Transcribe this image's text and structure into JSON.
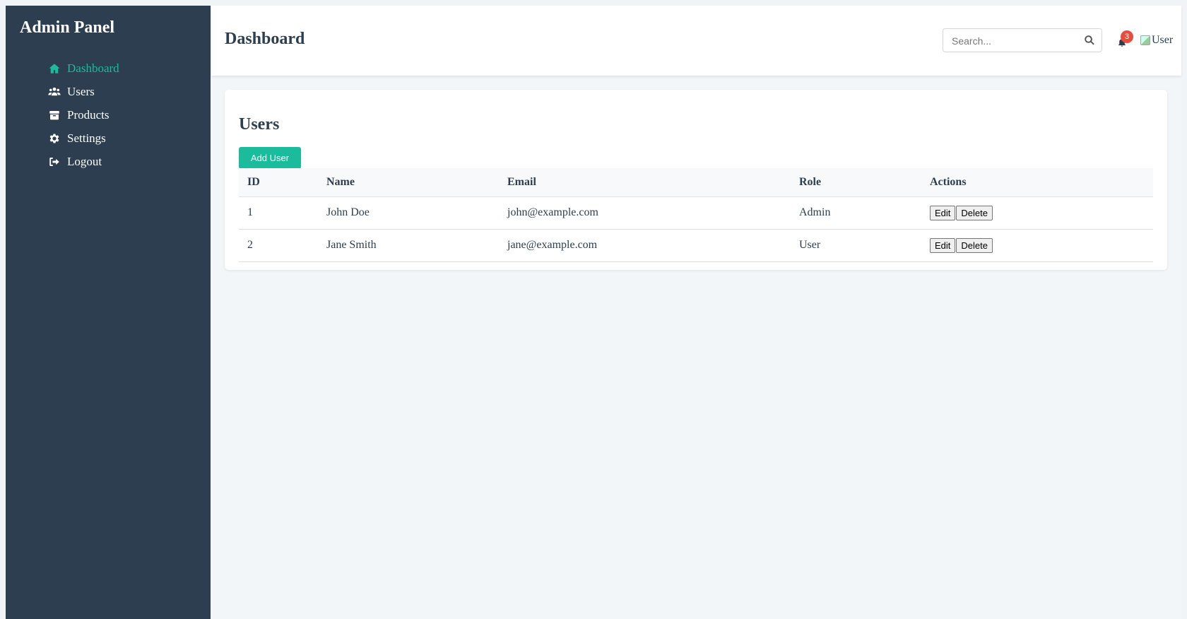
{
  "sidebar": {
    "title": "Admin Panel",
    "items": [
      {
        "label": "Dashboard",
        "icon": "home-icon",
        "active": true
      },
      {
        "label": "Users",
        "icon": "users-icon"
      },
      {
        "label": "Products",
        "icon": "box-icon"
      },
      {
        "label": "Settings",
        "icon": "gear-icon"
      },
      {
        "label": "Logout",
        "icon": "logout-icon"
      }
    ]
  },
  "header": {
    "title": "Dashboard",
    "search": {
      "placeholder": "Search...",
      "value": ""
    },
    "notifications": {
      "count": "3",
      "icon": "bell-icon"
    },
    "avatar_alt": "User"
  },
  "main": {
    "card_title": "Users",
    "add_button": "Add User",
    "table": {
      "columns": [
        "ID",
        "Name",
        "Email",
        "Role",
        "Actions"
      ],
      "rows": [
        {
          "id": "1",
          "name": "John Doe",
          "email": "john@example.com",
          "role": "Admin",
          "edit": "Edit",
          "delete": "Delete"
        },
        {
          "id": "2",
          "name": "Jane Smith",
          "email": "jane@example.com",
          "role": "User",
          "edit": "Edit",
          "delete": "Delete"
        }
      ]
    }
  },
  "colors": {
    "sidebar_bg": "#2c3e50",
    "accent": "#1abc9c",
    "badge": "#e74c3c",
    "page_bg": "#f3f6f9"
  }
}
